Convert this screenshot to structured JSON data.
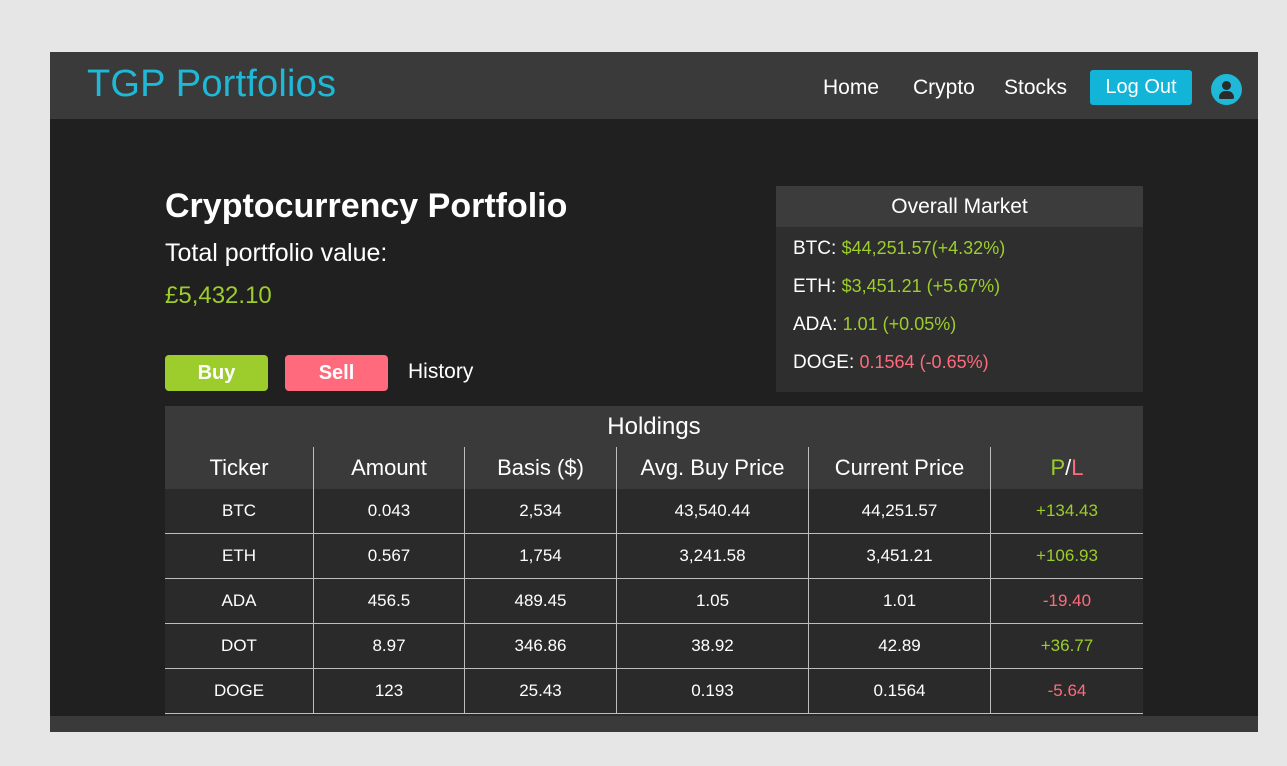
{
  "nav": {
    "brand": "TGP Portfolios",
    "links": [
      "Home",
      "Crypto",
      "Stocks"
    ],
    "logout_label": "Log Out"
  },
  "page": {
    "title": "Cryptocurrency Portfolio",
    "subtitle": "Total portfolio value:",
    "total_value": "£5,432.10",
    "buy_label": "Buy",
    "sell_label": "Sell",
    "history_label": "History"
  },
  "market": {
    "title": "Overall Market",
    "rows": [
      {
        "ticker": "BTC:",
        "value": "$44,251.57(+4.32%)",
        "trend": "up"
      },
      {
        "ticker": "ETH:",
        "value": "$3,451.21 (+5.67%)",
        "trend": "up"
      },
      {
        "ticker": "ADA:",
        "value": "1.01 (+0.05%)",
        "trend": "up"
      },
      {
        "ticker": "DOGE:",
        "value": "0.1564 (-0.65%)",
        "trend": "down"
      }
    ]
  },
  "holdings": {
    "title": "Holdings",
    "columns": [
      "Ticker",
      "Amount",
      "Basis ($)",
      "Avg. Buy Price",
      "Current Price"
    ],
    "pl_header": {
      "p": "P",
      "sep": "/",
      "l": "L"
    },
    "rows": [
      {
        "ticker": "BTC",
        "amount": "0.043",
        "basis": "2,534",
        "avg": "43,540.44",
        "current": "44,251.57",
        "pl": "+134.43"
      },
      {
        "ticker": "ETH",
        "amount": "0.567",
        "basis": "1,754",
        "avg": "3,241.58",
        "current": "3,451.21",
        "pl": "+106.93"
      },
      {
        "ticker": "ADA",
        "amount": "456.5",
        "basis": "489.45",
        "avg": "1.05",
        "current": "1.01",
        "pl": "-19.40"
      },
      {
        "ticker": "DOT",
        "amount": "8.97",
        "basis": "346.86",
        "avg": "38.92",
        "current": "42.89",
        "pl": "+36.77"
      },
      {
        "ticker": "DOGE",
        "amount": "123",
        "basis": "25.43",
        "avg": "0.193",
        "current": "0.1564",
        "pl": "-5.64"
      }
    ]
  },
  "colors": {
    "accent": "#1fb8d6",
    "positive": "#9ccd2c",
    "negative": "#ff6b7c",
    "background": "#202020"
  }
}
